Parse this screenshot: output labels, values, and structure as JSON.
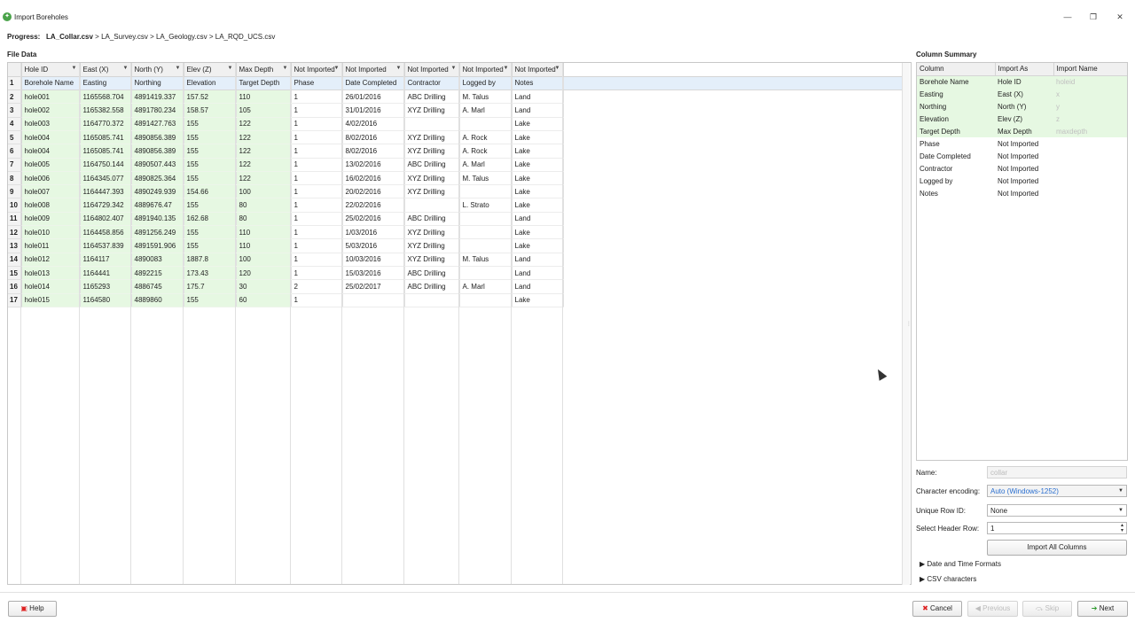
{
  "window": {
    "title": "Import Boreholes",
    "icon": "app-logo-icon",
    "controls": [
      "minimize-icon",
      "restore-icon",
      "close-icon"
    ]
  },
  "progress": {
    "label": "Progress:",
    "current": "LA_Collar.csv",
    "steps": [
      " > LA_Survey.csv",
      " > LA_Geology.csv",
      " > LA_RQD_UCS.csv"
    ]
  },
  "file_data": {
    "title": "File Data",
    "columns": [
      {
        "head": "Hole ID",
        "name": "Borehole Name",
        "imported": true
      },
      {
        "head": "East (X)",
        "name": "Easting",
        "imported": true
      },
      {
        "head": "North (Y)",
        "name": "Northing",
        "imported": true
      },
      {
        "head": "Elev (Z)",
        "name": "Elevation",
        "imported": true
      },
      {
        "head": "Max Depth",
        "name": "Target Depth",
        "imported": true
      },
      {
        "head": "Not Imported",
        "name": "Phase",
        "imported": false
      },
      {
        "head": "Not Imported",
        "name": "Date Completed",
        "imported": false
      },
      {
        "head": "Not Imported",
        "name": "Contractor",
        "imported": false
      },
      {
        "head": "Not Imported",
        "name": "Logged by",
        "imported": false
      },
      {
        "head": "Not Imported",
        "name": "Notes",
        "imported": false
      }
    ],
    "rows": [
      [
        "hole001",
        "1165568.704",
        "4891419.337",
        "157.52",
        "110",
        "1",
        "26/01/2016",
        "ABC Drilling",
        "M. Talus",
        "Land"
      ],
      [
        "hole002",
        "1165382.558",
        "4891780.234",
        "158.57",
        "105",
        "1",
        "31/01/2016",
        "XYZ Drilling",
        "A. Marl",
        "Land"
      ],
      [
        "hole003",
        "1164770.372",
        "4891427.763",
        "155",
        "122",
        "1",
        "4/02/2016",
        "",
        "",
        "Lake"
      ],
      [
        "hole004",
        "1165085.741",
        "4890856.389",
        "155",
        "122",
        "1",
        "8/02/2016",
        "XYZ Drilling",
        "A. Rock",
        "Lake"
      ],
      [
        "hole004",
        "1165085.741",
        "4890856.389",
        "155",
        "122",
        "1",
        "8/02/2016",
        "XYZ Drilling",
        "A. Rock",
        "Lake"
      ],
      [
        "hole005",
        "1164750.144",
        "4890507.443",
        "155",
        "122",
        "1",
        "13/02/2016",
        "ABC Drilling",
        "A. Marl",
        "Lake"
      ],
      [
        "hole006",
        "1164345.077",
        "4890825.364",
        "155",
        "122",
        "1",
        "16/02/2016",
        "XYZ Drilling",
        "M. Talus",
        "Lake"
      ],
      [
        "hole007",
        "1164447.393",
        "4890249.939",
        "154.66",
        "100",
        "1",
        "20/02/2016",
        "XYZ Drilling",
        "",
        "Lake"
      ],
      [
        "hole008",
        "1164729.342",
        "4889676.47",
        "155",
        "80",
        "1",
        "22/02/2016",
        "",
        "L. Strato",
        "Lake"
      ],
      [
        "hole009",
        "1164802.407",
        "4891940.135",
        "162.68",
        "80",
        "1",
        "25/02/2016",
        "ABC Drilling",
        "",
        "Land"
      ],
      [
        "hole010",
        "1164458.856",
        "4891256.249",
        "155",
        "110",
        "1",
        "1/03/2016",
        "XYZ Drilling",
        "",
        "Lake"
      ],
      [
        "hole011",
        "1164537.839",
        "4891591.906",
        "155",
        "110",
        "1",
        "5/03/2016",
        "XYZ Drilling",
        "",
        "Lake"
      ],
      [
        "hole012",
        "1164117",
        "4890083",
        "1887.8",
        "100",
        "1",
        "10/03/2016",
        "XYZ Drilling",
        "M. Talus",
        "Land"
      ],
      [
        "hole013",
        "1164441",
        "4892215",
        "173.43",
        "120",
        "1",
        "15/03/2016",
        "ABC Drilling",
        "",
        "Land"
      ],
      [
        "hole014",
        "1165293",
        "4886745",
        "175.7",
        "30",
        "2",
        "25/02/2017",
        "ABC Drilling",
        "A. Marl",
        "Land"
      ],
      [
        "hole015",
        "1164580",
        "4889860",
        "155",
        "60",
        "1",
        "",
        "",
        "",
        "Lake"
      ]
    ]
  },
  "column_summary": {
    "title": "Column Summary",
    "headers": [
      "Column",
      "Import As",
      "Import Name"
    ],
    "rows": [
      {
        "column": "Borehole Name",
        "import_as": "Hole ID",
        "import_name": "holeid",
        "imported": true
      },
      {
        "column": "Easting",
        "import_as": "East (X)",
        "import_name": "x",
        "imported": true
      },
      {
        "column": "Northing",
        "import_as": "North (Y)",
        "import_name": "y",
        "imported": true
      },
      {
        "column": "Elevation",
        "import_as": "Elev (Z)",
        "import_name": "z",
        "imported": true
      },
      {
        "column": "Target Depth",
        "import_as": "Max Depth",
        "import_name": "maxdepth",
        "imported": true
      },
      {
        "column": "Phase",
        "import_as": "Not Imported",
        "import_name": "",
        "imported": false
      },
      {
        "column": "Date Completed",
        "import_as": "Not Imported",
        "import_name": "",
        "imported": false
      },
      {
        "column": "Contractor",
        "import_as": "Not Imported",
        "import_name": "",
        "imported": false
      },
      {
        "column": "Logged by",
        "import_as": "Not Imported",
        "import_name": "",
        "imported": false
      },
      {
        "column": "Notes",
        "import_as": "Not Imported",
        "import_name": "",
        "imported": false
      }
    ]
  },
  "form": {
    "name_label": "Name:",
    "name_value": "collar",
    "encoding_label": "Character encoding:",
    "encoding_value": "Auto (Windows-1252)",
    "unique_row_label": "Unique Row ID:",
    "unique_row_value": "None",
    "header_row_label": "Select Header Row:",
    "header_row_value": "1",
    "import_all_label": "Import All Columns",
    "date_formats_label": "Date and Time Formats",
    "csv_chars_label": "CSV characters"
  },
  "footer": {
    "help_label": "Help",
    "cancel_label": "Cancel",
    "previous_label": "Previous",
    "skip_label": "Skip",
    "next_label": "Next"
  },
  "colors": {
    "imported_bg": "#e6f8e2",
    "header_row_bg": "#e4effa",
    "encoding_text": "#2a6fd0"
  }
}
